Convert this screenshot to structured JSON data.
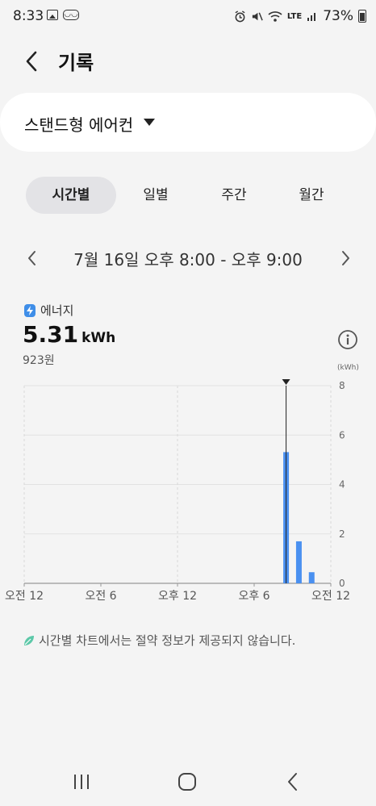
{
  "status_bar": {
    "time": "8:33",
    "network": "LTE",
    "battery": "73%",
    "icons": [
      "image-icon",
      "glasses-icon",
      "alarm-icon",
      "mute-icon",
      "wifi-icon",
      "lte-icon",
      "signal-icon",
      "battery-icon"
    ]
  },
  "header": {
    "title": "기록",
    "back_icon": "chevron-left-icon"
  },
  "device_selector": {
    "name": "스탠드형 에어컨",
    "caret_icon": "caret-down-icon"
  },
  "tabs": [
    {
      "label": "시간별",
      "active": true
    },
    {
      "label": "일별",
      "active": false
    },
    {
      "label": "주간",
      "active": false
    },
    {
      "label": "월간",
      "active": false
    }
  ],
  "date_nav": {
    "range": "7월 16일 오후 8:00 - 오후 9:00",
    "prev_icon": "chevron-left-icon",
    "next_icon": "chevron-right-icon"
  },
  "energy": {
    "label": "에너지",
    "value": "5.31",
    "unit": "kWh",
    "cost": "923원",
    "info_icon": "info-icon",
    "axis_unit": "(kWh)"
  },
  "colors": {
    "accent": "#4a90f0",
    "bolt": "#3f8ee8",
    "leaf": "#5cc8a8",
    "background": "#f4f4f4"
  },
  "chart_data": {
    "type": "bar",
    "ylabel": "(kWh)",
    "ylim": [
      0,
      8
    ],
    "y_ticks": [
      0,
      2,
      4,
      6,
      8
    ],
    "x_range_hours": [
      0,
      24
    ],
    "x_ticks": [
      {
        "hour": 0,
        "label": "오전 12"
      },
      {
        "hour": 6,
        "label": "오전 6"
      },
      {
        "hour": 12,
        "label": "오후 12"
      },
      {
        "hour": 18,
        "label": "오후 6"
      },
      {
        "hour": 24,
        "label": "오전 12"
      }
    ],
    "bars": [
      {
        "hour": 20,
        "value": 5.31
      },
      {
        "hour": 21,
        "value": 1.7
      },
      {
        "hour": 22,
        "value": 0.45
      }
    ],
    "selected_hour": 20,
    "grid": true
  },
  "note": {
    "text": "시간별 차트에서는 절약 정보가 제공되지 않습니다.",
    "icon": "leaf-icon"
  },
  "navbar": {
    "recent_icon": "recent-apps-icon",
    "home_icon": "home-icon",
    "back_icon": "back-icon"
  }
}
